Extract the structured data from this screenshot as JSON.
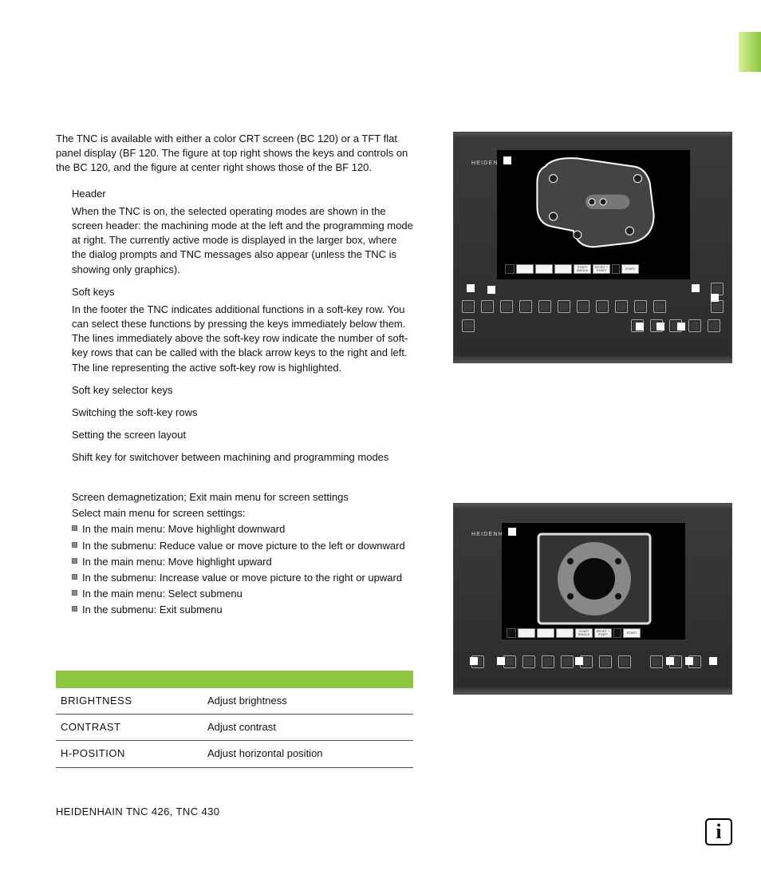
{
  "intro": "The TNC is available with either a color CRT screen (BC 120) or a TFT flat panel display (BF 120. The figure at top right shows the keys and controls on the BC 120, and the figure at center right shows those of the BF 120.",
  "sections": [
    {
      "head": "Header",
      "body": "When the TNC is on, the selected operating modes are shown in the screen header: the machining mode at the left and the programming mode at right. The currently active mode is displayed in the larger box, where the dialog prompts and TNC messages also appear (unless the TNC is showing only graphics)."
    },
    {
      "head": "Soft keys",
      "body": "In the footer the TNC indicates additional functions in a soft-key row. You can select these functions by pressing the keys immediately below them. The lines immediately above the soft-key row indicate the number of soft-key rows that can be called with the black arrow keys to the right and left. The line representing the active soft-key row is highlighted."
    },
    {
      "head": "Soft key selector keys",
      "body": ""
    },
    {
      "head": "Switching the soft-key rows",
      "body": ""
    },
    {
      "head": "Setting the screen layout",
      "body": ""
    },
    {
      "head": "Shift key for switchover between machining and programming modes",
      "body": ""
    }
  ],
  "settings_head1": "Screen demagnetization; Exit main menu for screen settings",
  "settings_head2": "Select main menu for screen settings:",
  "bullets": [
    "In the main menu: Move highlight downward",
    "In the submenu: Reduce value or move picture to the left or downward",
    "In the main menu: Move highlight upward",
    "In the submenu: Increase value or move picture to the right or upward",
    "In the main menu: Select submenu",
    "In the submenu: Exit submenu"
  ],
  "table": [
    {
      "c1": "BRIGHTNESS",
      "c2": "Adjust brightness"
    },
    {
      "c1": "CONTRAST",
      "c2": "Adjust contrast"
    },
    {
      "c1": "H-POSITION",
      "c2": "Adjust horizontal position"
    }
  ],
  "footer": "HEIDENHAIN TNC 426, TNC 430",
  "device_brand": "HEIDENHAIN",
  "softkeys1": [
    "",
    "",
    "",
    "",
    "START SINGLE",
    "RESET + START",
    "",
    "START"
  ],
  "softkeys2": [
    "",
    "",
    "",
    "",
    "START SINGLE",
    "RESET + START",
    "",
    "START"
  ]
}
